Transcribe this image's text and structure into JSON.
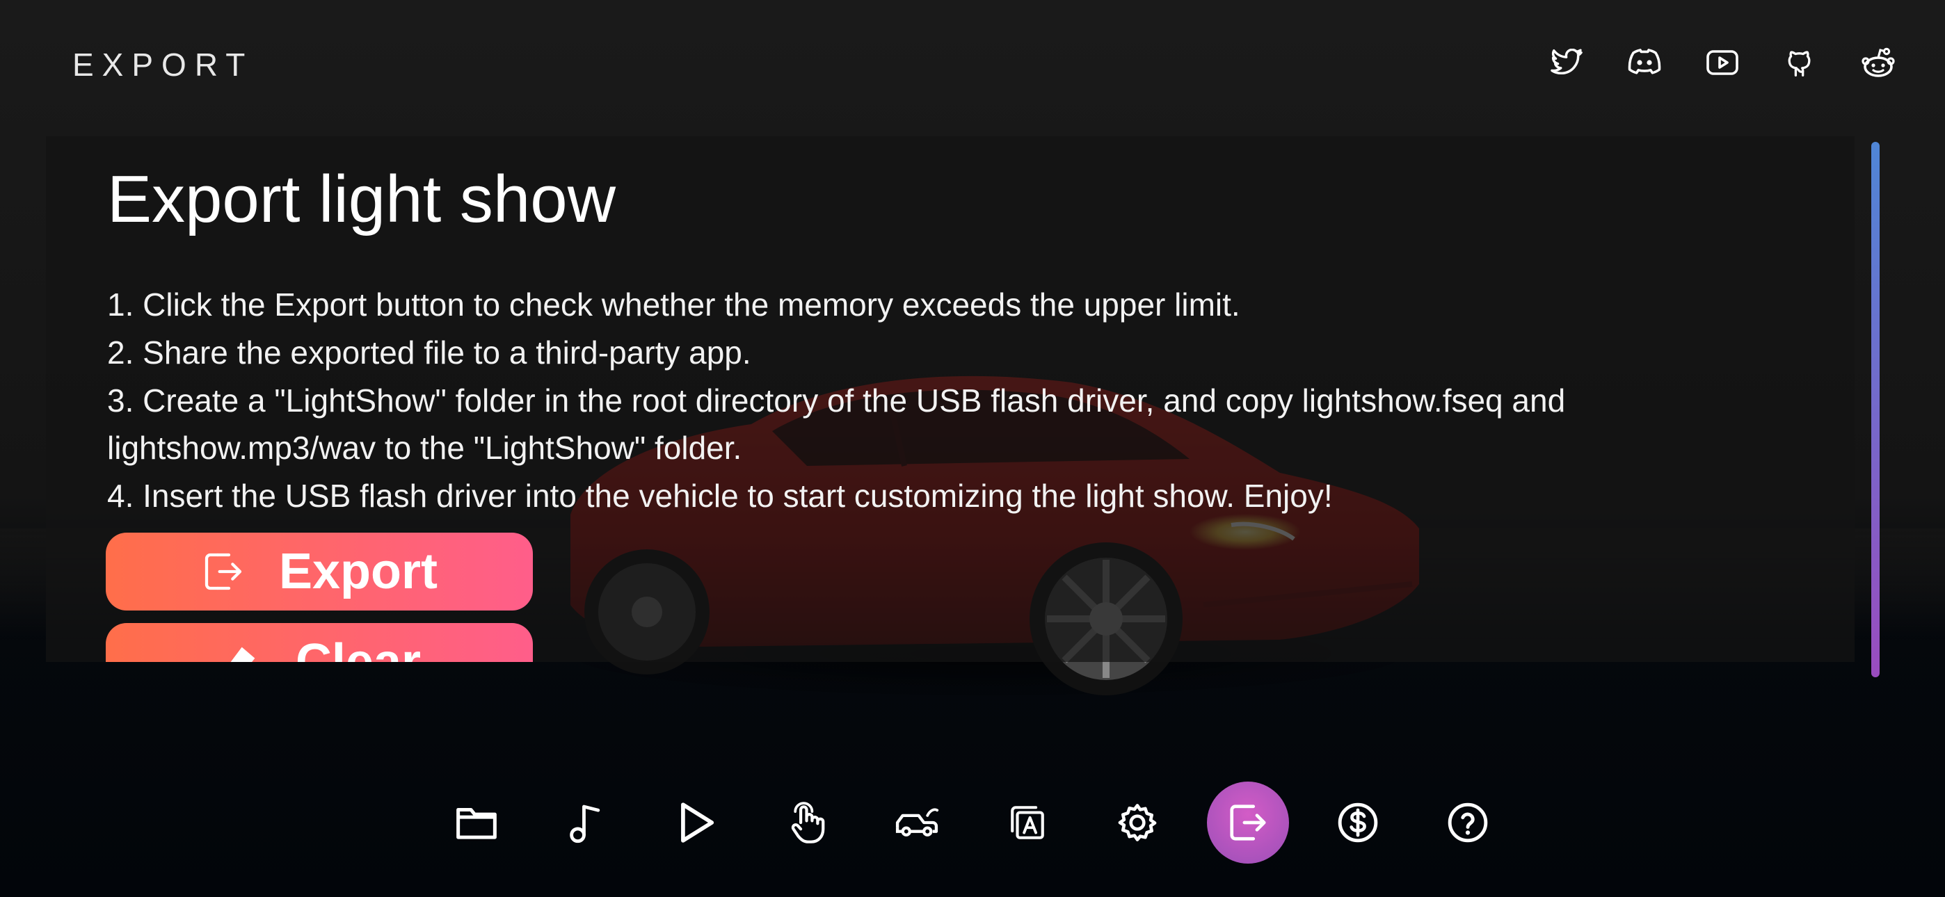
{
  "header": {
    "title": "EXPORT"
  },
  "social": [
    {
      "name": "twitter-icon"
    },
    {
      "name": "discord-icon"
    },
    {
      "name": "youtube-icon"
    },
    {
      "name": "github-icon"
    },
    {
      "name": "reddit-icon"
    }
  ],
  "panel": {
    "title": "Export light show",
    "steps": [
      "1. Click the Export button to check whether the memory exceeds the upper limit.",
      "2. Share the exported file to a third-party app.",
      "3. Create a \"LightShow\" folder in the root directory of the USB flash driver, and copy lightshow.fseq and",
      "lightshow.mp3/wav to the \"LightShow\" folder.",
      "4. Insert the USB flash driver into the vehicle to start customizing the light show. Enjoy!"
    ],
    "export_label": "Export",
    "clear_label": "Clear"
  },
  "toolbar": {
    "items": [
      {
        "icon": "folder-icon"
      },
      {
        "icon": "music-note-icon"
      },
      {
        "icon": "play-icon"
      },
      {
        "icon": "touch-icon"
      },
      {
        "icon": "car-icon"
      },
      {
        "icon": "text-layers-icon"
      },
      {
        "icon": "gear-icon"
      },
      {
        "icon": "export-icon",
        "active": true
      },
      {
        "icon": "dollar-icon"
      },
      {
        "icon": "help-icon"
      }
    ]
  },
  "colors": {
    "accent_gradient_start": "#ff6e4a",
    "accent_gradient_end": "#ff5e8a",
    "active_tab": "#b955c0",
    "scrollbar_top": "#4f86d6",
    "scrollbar_bottom": "#9a4cbf",
    "grid": "#2896dc",
    "car": "#b0120f"
  }
}
